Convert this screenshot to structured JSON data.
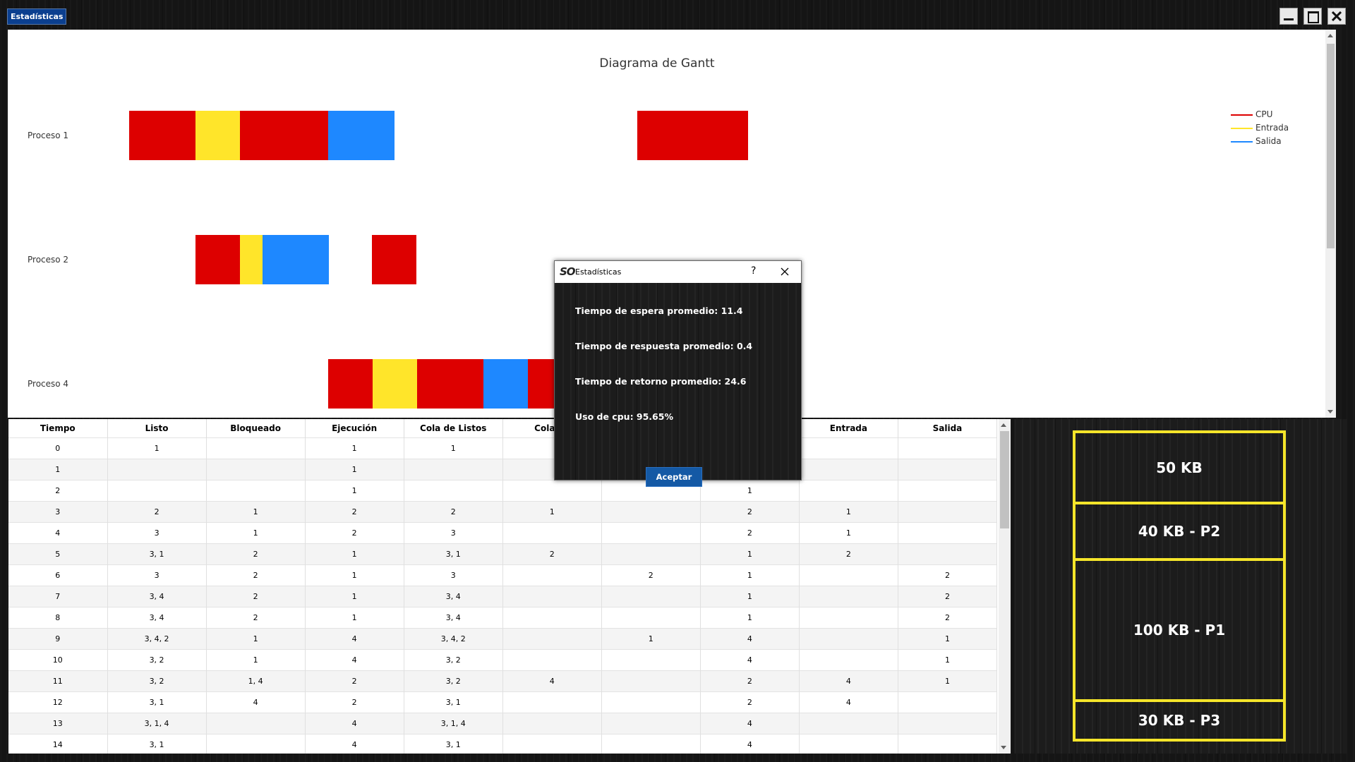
{
  "window": {
    "title": "Estadísticas"
  },
  "gantt": {
    "title": "Diagrama de Gantt",
    "colors": {
      "cpu": "#dd0000",
      "entrada": "#ffe52a",
      "salida": "#1e88ff"
    },
    "legend": [
      {
        "label": "CPU",
        "color": "#dd0000"
      },
      {
        "label": "Entrada",
        "color": "#ffe52a"
      },
      {
        "label": "Salida",
        "color": "#1e88ff"
      }
    ],
    "processes": [
      {
        "label": "Proceso 1"
      },
      {
        "label": "Proceso 2"
      },
      {
        "label": "Proceso 4"
      }
    ]
  },
  "table": {
    "headers": [
      "Tiempo",
      "Listo",
      "Bloqueado",
      "Ejecución",
      "Cola de Listos",
      "Cola de",
      "",
      "",
      "Entrada",
      "Salida"
    ],
    "rows": [
      [
        "0",
        "1",
        "",
        "1",
        "1",
        "",
        "",
        "",
        "",
        ""
      ],
      [
        "1",
        "",
        "",
        "1",
        "",
        "",
        "",
        "",
        "",
        ""
      ],
      [
        "2",
        "",
        "",
        "1",
        "",
        "",
        "",
        "1",
        "",
        ""
      ],
      [
        "3",
        "2",
        "1",
        "2",
        "2",
        "1",
        "",
        "2",
        "1",
        ""
      ],
      [
        "4",
        "3",
        "1",
        "2",
        "3",
        "",
        "",
        "2",
        "1",
        ""
      ],
      [
        "5",
        "3, 1",
        "2",
        "1",
        "3, 1",
        "2",
        "",
        "1",
        "2",
        ""
      ],
      [
        "6",
        "3",
        "2",
        "1",
        "3",
        "",
        "2",
        "1",
        "",
        "2"
      ],
      [
        "7",
        "3, 4",
        "2",
        "1",
        "3, 4",
        "",
        "",
        "1",
        "",
        "2"
      ],
      [
        "8",
        "3, 4",
        "2",
        "1",
        "3, 4",
        "",
        "",
        "1",
        "",
        "2"
      ],
      [
        "9",
        "3, 4, 2",
        "1",
        "4",
        "3, 4, 2",
        "",
        "1",
        "4",
        "",
        "1"
      ],
      [
        "10",
        "3, 2",
        "1",
        "4",
        "3, 2",
        "",
        "",
        "4",
        "",
        "1"
      ],
      [
        "11",
        "3, 2",
        "1, 4",
        "2",
        "3, 2",
        "4",
        "",
        "2",
        "4",
        "1"
      ],
      [
        "12",
        "3, 1",
        "4",
        "2",
        "3, 1",
        "",
        "",
        "2",
        "4",
        ""
      ],
      [
        "13",
        "3, 1, 4",
        "",
        "4",
        "3, 1, 4",
        "",
        "",
        "4",
        "",
        ""
      ],
      [
        "14",
        "3, 1",
        "",
        "4",
        "3, 1",
        "",
        "",
        "4",
        "",
        ""
      ]
    ]
  },
  "memory": {
    "border_color": "#f5e52a",
    "blocks": [
      "50 KB",
      "40 KB - P2",
      "100 KB - P1",
      "30 KB - P3"
    ]
  },
  "dialog": {
    "logo": "SO",
    "title": "Estadísticas",
    "help": "?",
    "lines": [
      "Tiempo de espera promedio: 11.4",
      "Tiempo de respuesta promedio: 0.4",
      "Tiempo de retorno promedio: 24.6",
      "Uso de cpu: 95.65%"
    ],
    "accept_label": "Aceptar"
  }
}
